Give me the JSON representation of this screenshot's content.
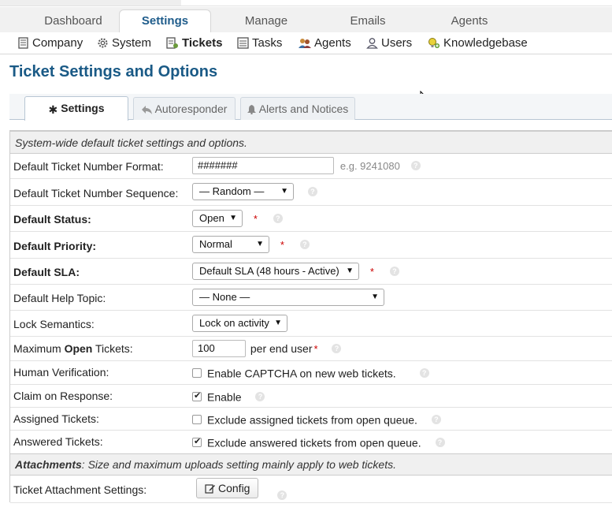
{
  "main_nav": {
    "tabs": [
      {
        "label": "Dashboard"
      },
      {
        "label": "Settings"
      },
      {
        "label": "Manage"
      },
      {
        "label": "Emails"
      },
      {
        "label": "Agents"
      }
    ]
  },
  "sub_nav": {
    "items": [
      {
        "label": "Company",
        "icon": "company-icon"
      },
      {
        "label": "System",
        "icon": "gear-icon"
      },
      {
        "label": "Tickets",
        "icon": "ticket-icon"
      },
      {
        "label": "Tasks",
        "icon": "tasks-icon"
      },
      {
        "label": "Agents",
        "icon": "agents-icon"
      },
      {
        "label": "Users",
        "icon": "user-icon"
      },
      {
        "label": "Knowledgebase",
        "icon": "knowledgebase-icon"
      }
    ]
  },
  "page": {
    "title": "Ticket Settings and Options"
  },
  "settings_tabs": [
    {
      "label": "Settings",
      "icon": "asterisk-icon"
    },
    {
      "label": "Autoresponder",
      "icon": "reply-icon"
    },
    {
      "label": "Alerts and Notices",
      "icon": "bell-icon"
    }
  ],
  "form": {
    "intro": "System-wide default ticket settings and options.",
    "ticket_number_format": {
      "label": "Default Ticket Number Format:",
      "value": "#######",
      "hint": "e.g. 9241080"
    },
    "ticket_number_sequence": {
      "label": "Default Ticket Number Sequence:",
      "value": "— Random —"
    },
    "default_status": {
      "label": "Default Status:",
      "value": "Open",
      "required": "*"
    },
    "default_priority": {
      "label": "Default Priority:",
      "value": "Normal",
      "required": "*"
    },
    "default_sla": {
      "label": "Default SLA:",
      "value": "Default SLA (48 hours - Active)",
      "required": "*"
    },
    "default_help_topic": {
      "label": "Default Help Topic:",
      "value": "— None —"
    },
    "lock_semantics": {
      "label": "Lock Semantics:",
      "value": "Lock on activity"
    },
    "max_open_tickets": {
      "label_pre": "Maximum ",
      "label_bold": "Open",
      "label_post": " Tickets:",
      "value": "100",
      "suffix": "per end user",
      "required": "*"
    },
    "human_verification": {
      "label": "Human Verification:",
      "text": "Enable CAPTCHA on new web tickets.",
      "checked": false
    },
    "claim_on_response": {
      "label": "Claim on Response:",
      "text": "Enable",
      "checked": true
    },
    "assigned_tickets": {
      "label": "Assigned Tickets:",
      "text": "Exclude assigned tickets from open queue.",
      "checked": false
    },
    "answered_tickets": {
      "label": "Answered Tickets:",
      "text": "Exclude answered tickets from open queue.",
      "checked": true
    },
    "attachments_header": {
      "bold": "Attachments",
      "text": ": Size and maximum uploads setting mainly apply to web tickets."
    },
    "attachment_settings": {
      "label": "Ticket Attachment Settings:",
      "button": "Config"
    }
  },
  "help_icon_glyph": "?",
  "colors": {
    "accent": "#1a5a86",
    "required": "#cc0000"
  }
}
